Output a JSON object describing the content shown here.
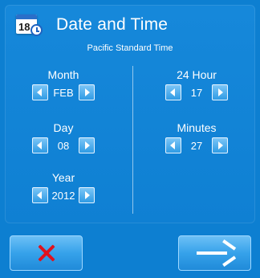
{
  "header": {
    "title": "Date and Time",
    "timezone": "Pacific Standard Time",
    "calendar_icon_number": "18"
  },
  "fields": {
    "month": {
      "label": "Month",
      "value": "FEB"
    },
    "day": {
      "label": "Day",
      "value": "08"
    },
    "year": {
      "label": "Year",
      "value": "2012"
    },
    "hour": {
      "label": "24 Hour",
      "value": "17"
    },
    "minutes": {
      "label": "Minutes",
      "value": "27"
    }
  },
  "icons": {
    "header_icon": "calendar-clock-icon",
    "decrement": "triangle-left-icon",
    "increment": "triangle-right-icon",
    "cancel": "red-x-icon",
    "next": "right-arrow-icon"
  },
  "colors": {
    "background": "#0d7fd1",
    "button_light": "#6cc0f6",
    "button_dark": "#1f8ad9",
    "cancel_red": "#e0121d",
    "text": "#ffffff"
  }
}
